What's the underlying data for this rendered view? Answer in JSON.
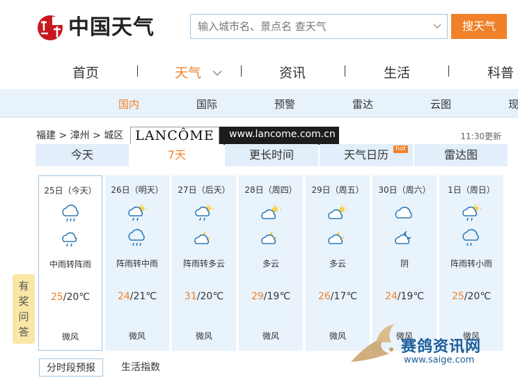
{
  "header": {
    "logo_text": "中国天气",
    "search_placeholder": "输入城市名、景点名 查天气",
    "search_button": "搜天气"
  },
  "nav": {
    "items": [
      "首页",
      "天气",
      "资讯",
      "生活",
      "科普"
    ],
    "active": "天气"
  },
  "subnav": {
    "items": [
      "国内",
      "国际",
      "预警",
      "雷达",
      "云图",
      "现"
    ],
    "active": "国内"
  },
  "breadcrumb": {
    "province": "福建",
    "city": "漳州",
    "district": "城区",
    "sep": ">"
  },
  "ad": {
    "brand": "LANCÔME",
    "url": "www.lancome.com.cn"
  },
  "update_time": "11:30更新",
  "tabs": {
    "items": [
      "今天",
      "7天",
      "更长时间",
      "天气日历",
      "雷达图"
    ],
    "active": "7天",
    "badge": "hot"
  },
  "forecast": [
    {
      "date": "25日（今天）",
      "icon1": "rain-icon",
      "icon2": "night-rain-icon",
      "desc": "中雨转阵雨",
      "high": "25",
      "low": "/20℃",
      "wind": "微风"
    },
    {
      "date": "26日（明天）",
      "icon1": "sun-rain-icon",
      "icon2": "rain-icon",
      "desc": "阵雨转中雨",
      "high": "24",
      "low": "/21℃",
      "wind": "微风"
    },
    {
      "date": "27日（后天）",
      "icon1": "sun-rain-icon",
      "icon2": "moon-cloud-icon",
      "desc": "阵雨转多云",
      "high": "31",
      "low": "/20℃",
      "wind": "微风"
    },
    {
      "date": "28日（周四）",
      "icon1": "sun-cloud-icon",
      "icon2": "moon-cloud-icon",
      "desc": "多云",
      "high": "29",
      "low": "/19℃",
      "wind": "微风"
    },
    {
      "date": "29日（周五）",
      "icon1": "sun-cloud-icon",
      "icon2": "moon-cloud-icon",
      "desc": "多云",
      "high": "26",
      "low": "/17℃",
      "wind": "微风"
    },
    {
      "date": "30日（周六）",
      "icon1": "cloud-icon",
      "icon2": "moon-cloud-icon",
      "desc": "阴",
      "high": "24",
      "low": "/19℃",
      "wind": "微风"
    },
    {
      "date": "1日（周日）",
      "icon1": "sun-rain-icon",
      "icon2": "rain-icon",
      "desc": "阵雨转小雨",
      "high": "25",
      "low": "/20℃",
      "wind": "微风"
    }
  ],
  "quiz": [
    "有",
    "奖",
    "问",
    "答"
  ],
  "bottom_tabs": [
    "分时段预报",
    "生活指数"
  ],
  "watermark": {
    "title": "赛鸽资讯网",
    "url": "www.saige.com"
  },
  "colors": {
    "accent": "#f08129",
    "tab_bg": "#e2eef9",
    "day_bg": "#e9f3fc",
    "icon_stroke": "#2d7ab8"
  }
}
